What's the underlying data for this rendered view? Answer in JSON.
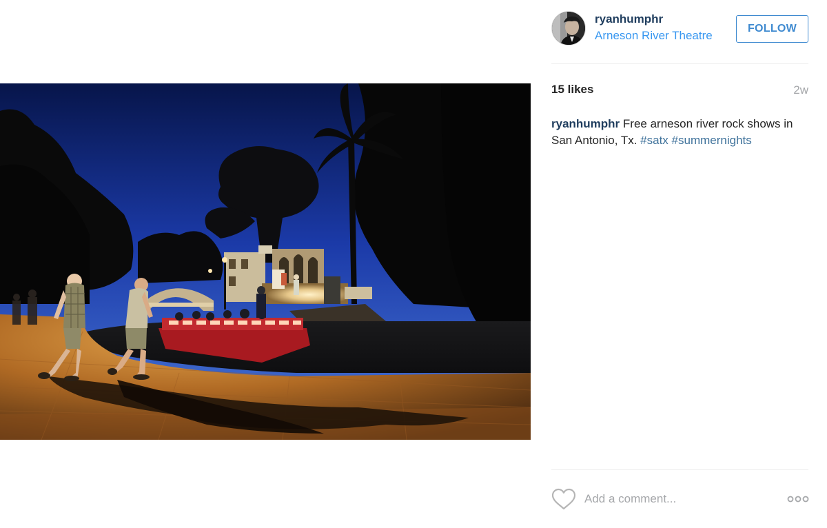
{
  "post": {
    "username": "ryanhumphr",
    "location": "Arneson River Theatre",
    "follow_label": "FOLLOW",
    "likes": "15 likes",
    "age": "2w",
    "caption": {
      "username": "ryanhumphr",
      "text": "Free arneson river rock shows in San Antonio, Tx.",
      "hashtags": [
        "#satx",
        "#summernights"
      ]
    },
    "comment_placeholder": "Add a comment...",
    "icons": {
      "avatar": "avatar-photo",
      "like": "heart-icon",
      "more": "more-options-icon"
    },
    "colors": {
      "username": "#1f3d5e",
      "location": "#3897f0",
      "follow": "#3f8ad0",
      "hashtag": "#3f729b",
      "muted": "#a5a7aa"
    }
  }
}
